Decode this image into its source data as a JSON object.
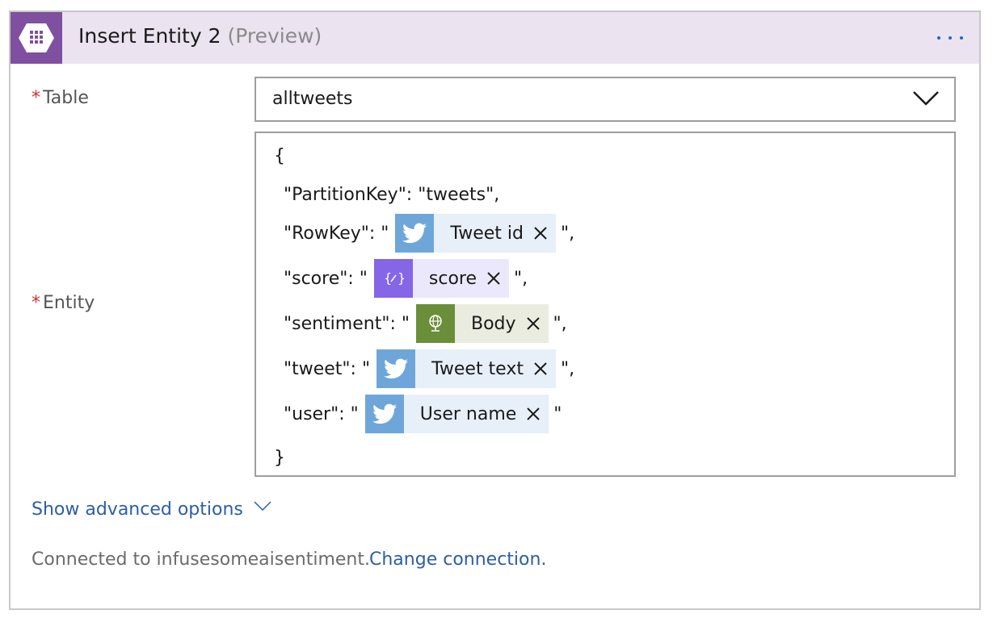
{
  "header": {
    "title": "Insert Entity 2",
    "subtitle": "(Preview)",
    "icon": "azure-table-icon",
    "more_icon": "ellipsis-icon",
    "accent_color": "#7f4fa0"
  },
  "fields": {
    "table": {
      "label": "Table",
      "required_mark": "*",
      "value": "alltweets"
    },
    "entity": {
      "label": "Entity",
      "required_mark": "*",
      "lines": {
        "open": "{",
        "partition": "\"PartitionKey\": \"tweets\",",
        "rowkey_prefix": "\"RowKey\": \"",
        "rowkey_suffix": "\",",
        "score_prefix": "\"score\": \"",
        "score_suffix": "\",",
        "sentiment_prefix": "\"sentiment\": \"",
        "sentiment_suffix": "\",",
        "tweet_prefix": "\"tweet\": \"",
        "tweet_suffix": "\",",
        "user_prefix": "\"user\": \"",
        "user_suffix": "\"",
        "close": "}"
      },
      "tokens": {
        "rowkey": {
          "label": "Tweet id",
          "icon": "twitter-icon"
        },
        "score": {
          "label": "score",
          "icon": "variable-icon"
        },
        "sentiment": {
          "label": "Body",
          "icon": "globe-icon"
        },
        "tweet": {
          "label": "Tweet text",
          "icon": "twitter-icon"
        },
        "user": {
          "label": "User name",
          "icon": "twitter-icon"
        }
      }
    }
  },
  "advanced": {
    "label": "Show advanced options"
  },
  "connection": {
    "status": "Connected to infusesomeaisentiment.",
    "change_label": "Change connection."
  },
  "colors": {
    "twitter": "#6fa6d9",
    "variable": "#8566e6",
    "globe": "#6b8e3a",
    "link": "#2c5ea8",
    "required": "#d32f2f"
  }
}
